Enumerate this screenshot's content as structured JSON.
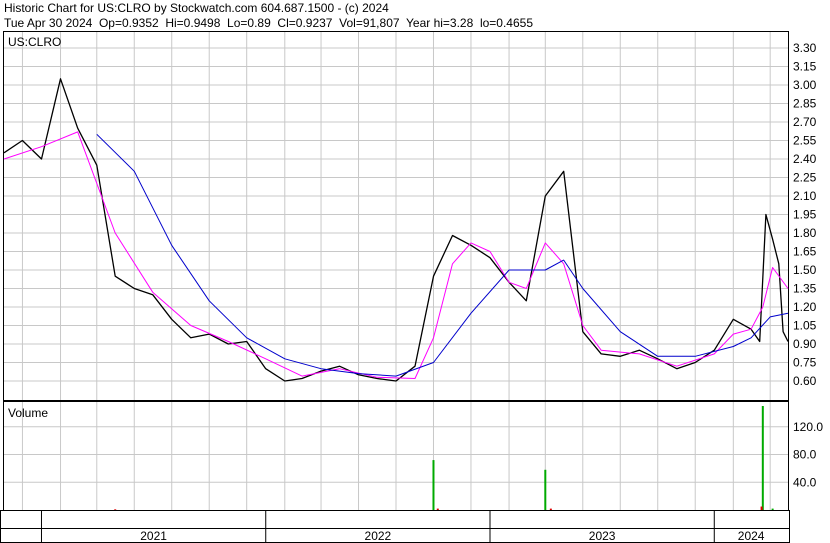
{
  "header": {
    "line1": "Historic Chart for US:CLRO by Stockwatch.com 604.687.1500 - (c) 2024",
    "line2": "Tue Apr 30 2024  Op=0.9352  Hi=0.9498  Lo=0.89  Cl=0.9237  Vol=91,807  Year hi=3.28  lo=0.4655"
  },
  "price_panel": {
    "symbol_label": "US:CLRO"
  },
  "volume_panel": {
    "label": "Volume"
  },
  "colors": {
    "price": "#000000",
    "ma_short": "#ff00ff",
    "ma_long": "#0000cc",
    "volume_up": "#00aa00",
    "volume_down": "#dd0000",
    "grid": "#c8c8c8"
  },
  "chart_data": [
    {
      "type": "line",
      "title": "US:CLRO",
      "ylim": [
        0.5,
        3.35
      ],
      "y_ticks": [
        "3.30",
        "3.15",
        "3.00",
        "2.85",
        "2.70",
        "2.55",
        "2.40",
        "2.25",
        "2.10",
        "1.95",
        "1.80",
        "1.65",
        "1.50",
        "1.35",
        "1.20",
        "1.05",
        "0.90",
        "0.75",
        "0.60"
      ],
      "x_labels": [
        "2021",
        "2022",
        "2023",
        "2024"
      ],
      "x_range": [
        "2020-11",
        "2024-04-30"
      ],
      "grid": true,
      "series": [
        {
          "role": "price",
          "points": [
            [
              "2020-11",
              2.45
            ],
            [
              "2020-12",
              2.55
            ],
            [
              "2021-01",
              2.4
            ],
            [
              "2021-02",
              3.05
            ],
            [
              "2021-03",
              2.65
            ],
            [
              "2021-04",
              2.35
            ],
            [
              "2021-05",
              1.45
            ],
            [
              "2021-06",
              1.35
            ],
            [
              "2021-07",
              1.3
            ],
            [
              "2021-08",
              1.1
            ],
            [
              "2021-09",
              0.95
            ],
            [
              "2021-10",
              0.98
            ],
            [
              "2021-11",
              0.9
            ],
            [
              "2021-12",
              0.92
            ],
            [
              "2022-01",
              0.7
            ],
            [
              "2022-02",
              0.6
            ],
            [
              "2022-03",
              0.62
            ],
            [
              "2022-04",
              0.68
            ],
            [
              "2022-05",
              0.72
            ],
            [
              "2022-06",
              0.65
            ],
            [
              "2022-07",
              0.62
            ],
            [
              "2022-08",
              0.6
            ],
            [
              "2022-09",
              0.72
            ],
            [
              "2022-10",
              1.45
            ],
            [
              "2022-11",
              1.78
            ],
            [
              "2022-12",
              1.7
            ],
            [
              "2023-01",
              1.6
            ],
            [
              "2023-02",
              1.4
            ],
            [
              "2023-03",
              1.25
            ],
            [
              "2023-04",
              2.1
            ],
            [
              "2023-05",
              2.3
            ],
            [
              "2023-06",
              1.0
            ],
            [
              "2023-07",
              0.82
            ],
            [
              "2023-08",
              0.8
            ],
            [
              "2023-09",
              0.85
            ],
            [
              "2023-10",
              0.78
            ],
            [
              "2023-11",
              0.7
            ],
            [
              "2023-12",
              0.75
            ],
            [
              "2024-01",
              0.85
            ],
            [
              "2024-02",
              1.1
            ],
            [
              "2024-03",
              1.02
            ],
            [
              "2024-03-15",
              0.92
            ],
            [
              "2024-03-25",
              1.95
            ],
            [
              "2024-04-05",
              1.75
            ],
            [
              "2024-04-15",
              1.55
            ],
            [
              "2024-04-22",
              1.0
            ],
            [
              "2024-04-30",
              0.92
            ]
          ]
        },
        {
          "role": "moving-average-short",
          "points": [
            [
              "2020-11",
              2.4
            ],
            [
              "2021-01",
              2.5
            ],
            [
              "2021-03",
              2.62
            ],
            [
              "2021-05",
              1.8
            ],
            [
              "2021-07",
              1.32
            ],
            [
              "2021-09",
              1.05
            ],
            [
              "2021-11",
              0.92
            ],
            [
              "2022-01",
              0.78
            ],
            [
              "2022-03",
              0.64
            ],
            [
              "2022-05",
              0.7
            ],
            [
              "2022-07",
              0.63
            ],
            [
              "2022-09",
              0.62
            ],
            [
              "2022-10",
              0.95
            ],
            [
              "2022-11",
              1.55
            ],
            [
              "2022-12",
              1.72
            ],
            [
              "2023-01",
              1.65
            ],
            [
              "2023-02",
              1.4
            ],
            [
              "2023-03",
              1.35
            ],
            [
              "2023-04",
              1.72
            ],
            [
              "2023-05",
              1.55
            ],
            [
              "2023-06",
              1.05
            ],
            [
              "2023-07",
              0.85
            ],
            [
              "2023-09",
              0.82
            ],
            [
              "2023-11",
              0.72
            ],
            [
              "2024-01",
              0.82
            ],
            [
              "2024-02",
              0.98
            ],
            [
              "2024-03",
              1.02
            ],
            [
              "2024-03-20",
              1.2
            ],
            [
              "2024-04-05",
              1.52
            ],
            [
              "2024-04-30",
              1.35
            ]
          ]
        },
        {
          "role": "moving-average-long",
          "points": [
            [
              "2021-04",
              2.6
            ],
            [
              "2021-06",
              2.3
            ],
            [
              "2021-08",
              1.7
            ],
            [
              "2021-10",
              1.25
            ],
            [
              "2021-12",
              0.95
            ],
            [
              "2022-02",
              0.78
            ],
            [
              "2022-04",
              0.7
            ],
            [
              "2022-06",
              0.66
            ],
            [
              "2022-08",
              0.64
            ],
            [
              "2022-10",
              0.75
            ],
            [
              "2022-12",
              1.15
            ],
            [
              "2023-02",
              1.5
            ],
            [
              "2023-04",
              1.5
            ],
            [
              "2023-05",
              1.58
            ],
            [
              "2023-06",
              1.35
            ],
            [
              "2023-08",
              1.0
            ],
            [
              "2023-10",
              0.8
            ],
            [
              "2023-12",
              0.8
            ],
            [
              "2024-02",
              0.88
            ],
            [
              "2024-03",
              0.95
            ],
            [
              "2024-04",
              1.12
            ],
            [
              "2024-04-30",
              1.15
            ]
          ]
        }
      ]
    },
    {
      "type": "bar",
      "title": "Volume",
      "ylim": [
        0,
        150
      ],
      "y_ticks": [
        "120.0",
        "80.0",
        "40.0"
      ],
      "bars": [
        {
          "x": "2021-05",
          "value": 1,
          "direction": "down"
        },
        {
          "x": "2022-10",
          "value": 72,
          "direction": "up"
        },
        {
          "x": "2022-10-08",
          "value": 2,
          "direction": "down"
        },
        {
          "x": "2023-04",
          "value": 58,
          "direction": "up"
        },
        {
          "x": "2023-04-10",
          "value": 2,
          "direction": "down"
        },
        {
          "x": "2024-03-20",
          "value": 150,
          "direction": "up"
        },
        {
          "x": "2024-03-18",
          "value": 5,
          "direction": "down"
        },
        {
          "x": "2024-04-05",
          "value": 2,
          "direction": "up"
        }
      ]
    }
  ]
}
